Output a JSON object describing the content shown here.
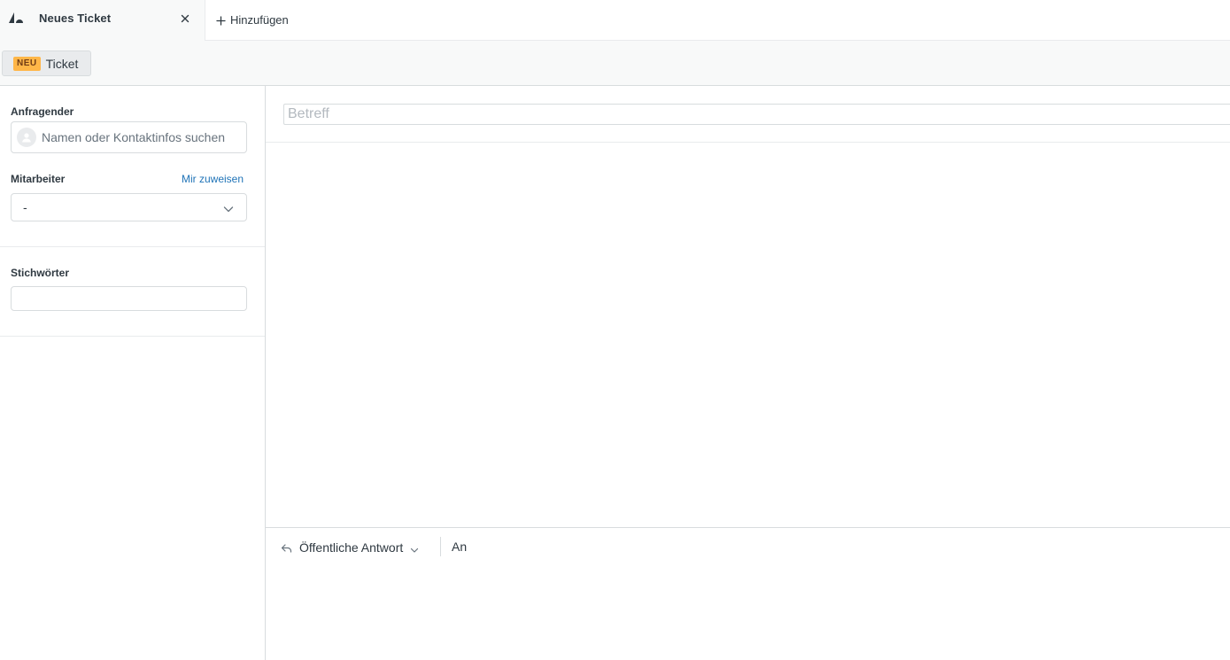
{
  "tabs": {
    "active_tab_title": "Neues Ticket",
    "add_tab_label": "Hinzufügen"
  },
  "header": {
    "badge": "NEU",
    "title": "Ticket"
  },
  "sidebar": {
    "requester_label": "Anfragender",
    "requester_placeholder": "Namen oder Kontaktinfos suchen",
    "assignee_label": "Mitarbeiter",
    "assign_to_me": "Mir zuweisen",
    "assignee_value": "-",
    "tags_label": "Stichwörter",
    "tags_value": ""
  },
  "main": {
    "subject_placeholder": "Betreff",
    "reply_type": "Öffentliche Antwort",
    "to_label": "An"
  },
  "colors": {
    "link": "#1f73b7",
    "badge_new": "#ffb648",
    "border": "#d8dcde",
    "text": "#2f3941"
  },
  "icons": [
    "logo-icon",
    "close-icon",
    "plus-icon",
    "avatar-icon",
    "chevron-down-icon",
    "reply-icon"
  ]
}
